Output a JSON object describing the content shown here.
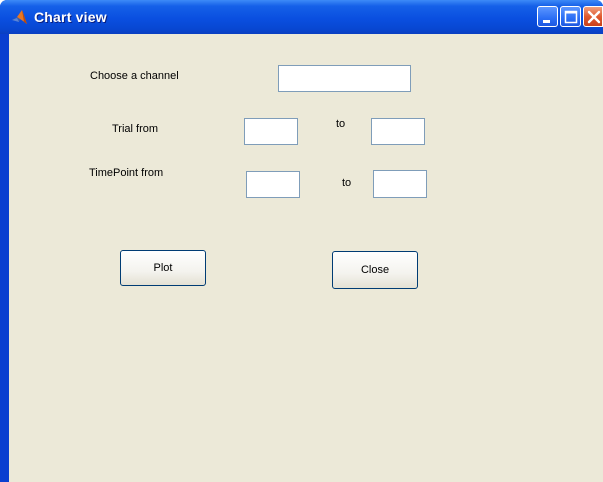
{
  "window": {
    "title": "Chart view"
  },
  "form": {
    "channel_label": "Choose a channel",
    "channel_value": "",
    "trial_label": "Trial from",
    "trial_from_value": "",
    "trial_to_label": "to",
    "trial_to_value": "",
    "timepoint_label": "TimePoint from",
    "timepoint_from_value": "",
    "timepoint_to_label": "to",
    "timepoint_to_value": ""
  },
  "buttons": {
    "plot": "Plot",
    "close": "Close"
  },
  "icons": {
    "app": "matlab-icon",
    "minimize": "minimize-icon",
    "maximize": "maximize-icon",
    "close": "close-icon"
  },
  "colors": {
    "title_bar": "#0a4fe0",
    "client_bg": "#ece9d8",
    "close_button": "#e05a30"
  }
}
